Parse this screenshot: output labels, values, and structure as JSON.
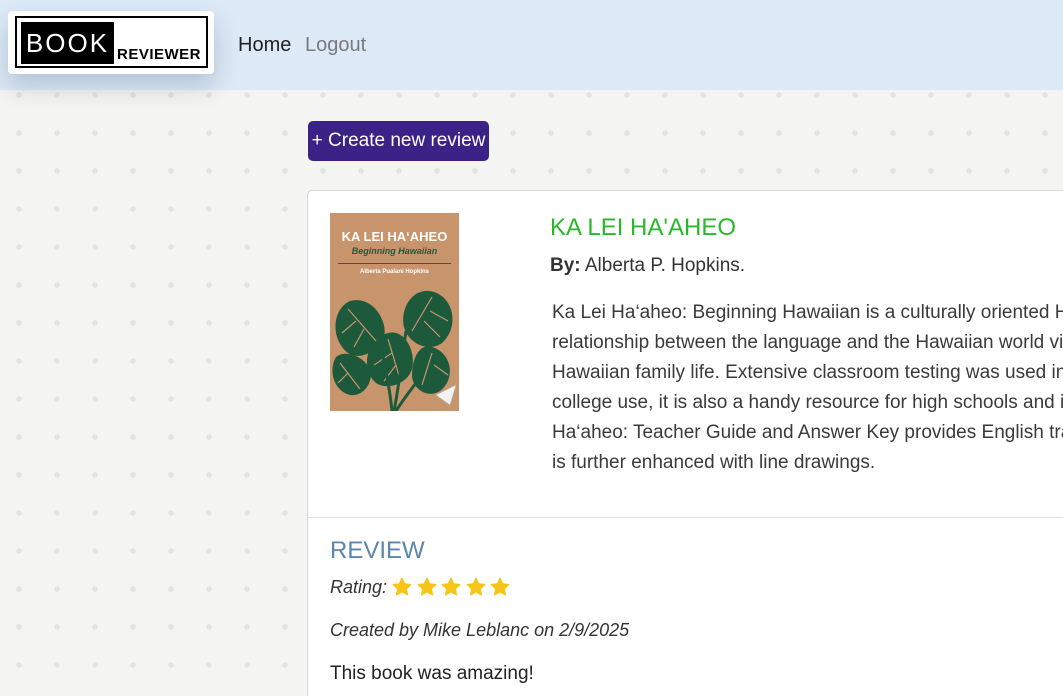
{
  "logo": {
    "word1": "BOOK",
    "word2": "REVIEWER"
  },
  "nav": {
    "home": "Home",
    "logout": "Logout"
  },
  "actions": {
    "create_label": "+ Create new review"
  },
  "book": {
    "title": "KA LEI HA'AHEO",
    "by_label": "By:",
    "author": "Alberta P. Hopkins.",
    "cover": {
      "title": "KA LEI HA‘AHEO",
      "subtitle": "Beginning Hawaiian",
      "author": "Alberta Pualani Hopkins"
    },
    "description_lines": [
      "Ka Lei Ha‘aheo: Beginning Hawaiian is a culturally oriented Ha",
      "relationship between the language and the Hawaiian world vi",
      "Hawaiian family life. Extensive classroom testing was used in",
      "college use, it is also a handy resource for high schools and in",
      "Ha‘aheo: Teacher Guide and Answer Key provides English tran",
      "is further enhanced with line drawings."
    ]
  },
  "review": {
    "heading": "REVIEW",
    "rating_label": "Rating:",
    "rating": 5,
    "rating_max": 5,
    "star_color": "#f5c518",
    "created_text": "Created by Mike Leblanc on 2/9/2025",
    "text": "This book was amazing!"
  }
}
